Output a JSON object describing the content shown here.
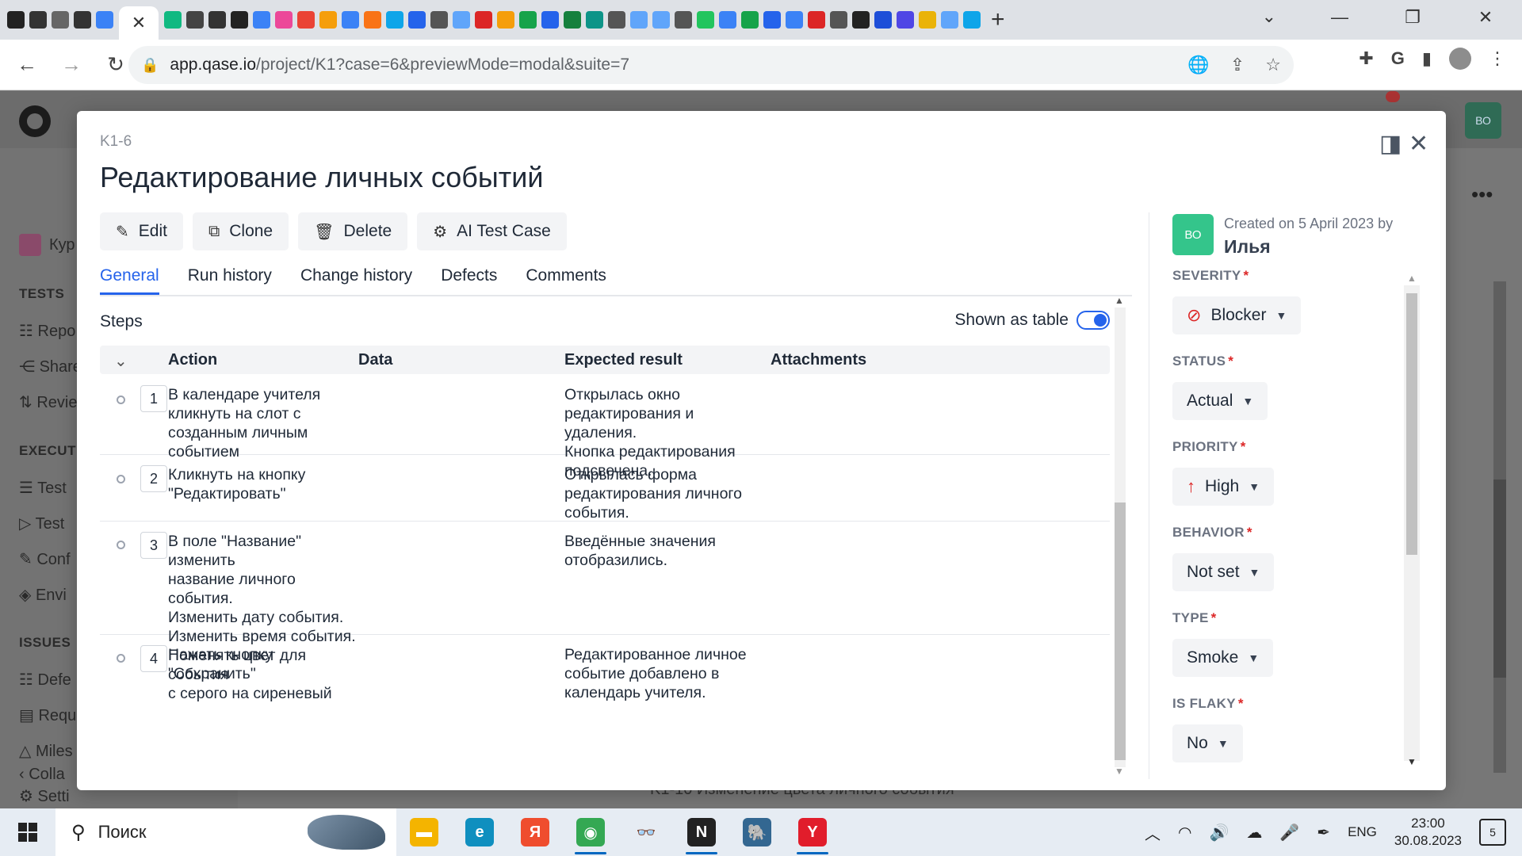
{
  "browser": {
    "url_host": "app.qase.io",
    "url_path": "/project/K1?case=6&previewMode=modal&suite=7",
    "tab_favicons": [
      {
        "name": "favicon-1",
        "color": "#222"
      },
      {
        "name": "favicon-notion",
        "color": "#333"
      },
      {
        "name": "favicon-3",
        "color": "#666"
      },
      {
        "name": "favicon-notion-2",
        "color": "#333"
      },
      {
        "name": "favicon-5",
        "color": "#3b82f6"
      },
      {
        "name": "favicon-6",
        "color": "#10b981"
      },
      {
        "name": "favicon-7",
        "color": "#444"
      },
      {
        "name": "favicon-8",
        "color": "#333"
      },
      {
        "name": "favicon-9",
        "color": "#222"
      },
      {
        "name": "favicon-10",
        "color": "#3b82f6"
      },
      {
        "name": "favicon-11",
        "color": "#ec4899"
      },
      {
        "name": "favicon-google",
        "color": "#ea4335"
      },
      {
        "name": "favicon-13",
        "color": "#f59e0b"
      },
      {
        "name": "favicon-14",
        "color": "#3b82f6"
      },
      {
        "name": "favicon-15",
        "color": "#f97316"
      },
      {
        "name": "favicon-16",
        "color": "#0ea5e9"
      },
      {
        "name": "favicon-17",
        "color": "#2563eb"
      },
      {
        "name": "favicon-18",
        "color": "#555"
      },
      {
        "name": "favicon-19",
        "color": "#60a5fa"
      },
      {
        "name": "favicon-20",
        "color": "#dc2626"
      },
      {
        "name": "favicon-21",
        "color": "#f59e0b"
      },
      {
        "name": "favicon-22",
        "color": "#16a34a"
      },
      {
        "name": "favicon-23",
        "color": "#2563eb"
      },
      {
        "name": "favicon-24",
        "color": "#15803d"
      },
      {
        "name": "favicon-25",
        "color": "#0d9488"
      },
      {
        "name": "favicon-26",
        "color": "#555"
      },
      {
        "name": "favicon-27",
        "color": "#60a5fa"
      },
      {
        "name": "favicon-28",
        "color": "#60a5fa"
      },
      {
        "name": "favicon-29",
        "color": "#555"
      },
      {
        "name": "favicon-30",
        "color": "#22c55e"
      },
      {
        "name": "favicon-31",
        "color": "#3b82f6"
      },
      {
        "name": "favicon-32",
        "color": "#16a34a"
      },
      {
        "name": "favicon-33",
        "color": "#2563eb"
      },
      {
        "name": "favicon-34",
        "color": "#3b82f6"
      },
      {
        "name": "favicon-35",
        "color": "#dc2626"
      },
      {
        "name": "favicon-36",
        "color": "#555"
      },
      {
        "name": "favicon-37",
        "color": "#222"
      },
      {
        "name": "favicon-38",
        "color": "#1d4ed8"
      },
      {
        "name": "favicon-39",
        "color": "#4f46e5"
      },
      {
        "name": "favicon-40",
        "color": "#eab308"
      },
      {
        "name": "favicon-41",
        "color": "#60a5fa"
      },
      {
        "name": "favicon-42",
        "color": "#0ea5e9"
      }
    ]
  },
  "background_app": {
    "user_initials": "ВО",
    "sidebar": {
      "project": "Кур",
      "tests_heading": "TESTS",
      "tests_items": [
        "Repo",
        "Share",
        "Revie"
      ],
      "execution_heading": "EXECUTI",
      "execution_items": [
        "Test",
        "Test",
        "Conf",
        "Envi"
      ],
      "issues_heading": "ISSUES",
      "issues_items": [
        "Defe",
        "Requ",
        "Miles"
      ],
      "footer_items": [
        "Setti",
        "Colla"
      ]
    },
    "partial_row": "K1-10   Изменение цвета личного события"
  },
  "modal": {
    "case_id": "K1-6",
    "title": "Редактирование личных событий",
    "actions": [
      {
        "label": "Edit",
        "icon": "pencil-icon",
        "glyph": "✎"
      },
      {
        "label": "Clone",
        "icon": "clone-icon",
        "glyph": "⧉"
      },
      {
        "label": "Delete",
        "icon": "trash-icon",
        "glyph": "🗑"
      },
      {
        "label": "AI Test Case",
        "icon": "ai-chip-icon",
        "glyph": "⚙"
      }
    ],
    "tabs": [
      {
        "label": "General",
        "active": true
      },
      {
        "label": "Run history",
        "active": false
      },
      {
        "label": "Change history",
        "active": false
      },
      {
        "label": "Defects",
        "active": false
      },
      {
        "label": "Comments",
        "active": false
      }
    ],
    "steps_label": "Steps",
    "shown_as_table_label": "Shown as table",
    "shown_as_table_on": true,
    "columns": {
      "action": "Action",
      "data": "Data",
      "expected": "Expected result",
      "attachments": "Attachments"
    },
    "steps": [
      {
        "num": "1",
        "action": "В календаре учителя\nкликнуть на слот с\nсозданным личным\nсобытием",
        "data": "",
        "expected": "Открылась окно\nредактирования и удаления.\nКнопка редактирования\nподсвечена."
      },
      {
        "num": "2",
        "action": "Кликнуть на кнопку\n\"Редактировать\"",
        "data": "",
        "expected": "Открылась форма\nредактирования личного\nсобытия."
      },
      {
        "num": "3",
        "action": "В поле \"Название\" изменить\nназвание личного события.\nИзменить дату события.\nИзменить время события.\nПоменять цвет для события\nс серого на сиреневый",
        "data": "",
        "expected": "Введённые значения\nотобразились."
      },
      {
        "num": "4",
        "action": "Нажать кнопку \"Сохранить\"",
        "data": "",
        "expected": "Редактированное личное\nсобытие добавлено в\nкалендарь учителя."
      }
    ]
  },
  "right_panel": {
    "avatar_initials": "ВО",
    "created_on": "Created on 5 April 2023 by",
    "creator": "Илья",
    "properties": [
      {
        "label": "SEVERITY",
        "value": "Blocker",
        "icon": "blocker-icon"
      },
      {
        "label": "STATUS",
        "value": "Actual",
        "icon": ""
      },
      {
        "label": "PRIORITY",
        "value": "High",
        "icon": "arrow-up-icon"
      },
      {
        "label": "BEHAVIOR",
        "value": "Not set",
        "icon": ""
      },
      {
        "label": "TYPE",
        "value": "Smoke",
        "icon": ""
      },
      {
        "label": "IS FLAKY",
        "value": "No",
        "icon": ""
      }
    ]
  },
  "taskbar": {
    "search_placeholder": "Поиск",
    "apps": [
      {
        "name": "file-explorer",
        "glyph": "▬",
        "color": "#f4b400",
        "active": false
      },
      {
        "name": "edge",
        "glyph": "e",
        "color": "#0f8fbf",
        "active": false
      },
      {
        "name": "yandex",
        "glyph": "Я",
        "color": "#ef4d2e",
        "active": false
      },
      {
        "name": "chrome",
        "glyph": "◉",
        "color": "#34a853",
        "active": true
      },
      {
        "name": "glasses-app",
        "glyph": "👓",
        "color": "#e6ecf3",
        "active": false
      },
      {
        "name": "notion",
        "glyph": "N",
        "color": "#222",
        "active": true
      },
      {
        "name": "postgres",
        "glyph": "🐘",
        "color": "#336791",
        "active": false
      },
      {
        "name": "yandex-browser",
        "glyph": "Y",
        "color": "#e11d2b",
        "active": true
      }
    ],
    "language": "ENG",
    "time": "23:00",
    "date": "30.08.2023",
    "notification_count": "5"
  }
}
